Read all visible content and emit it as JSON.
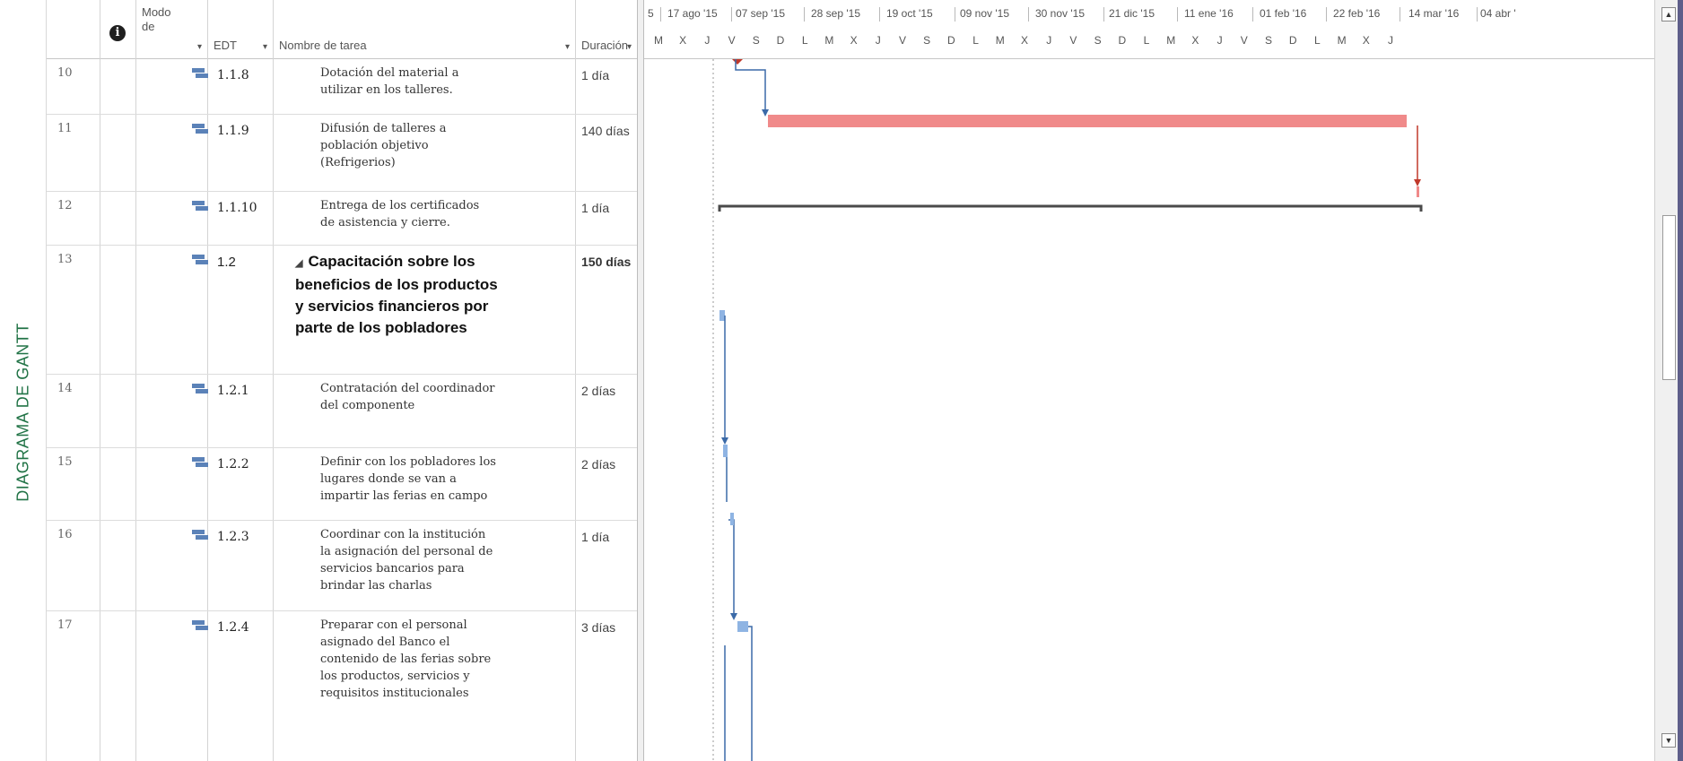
{
  "view_label": "DIAGRAMA DE GANTT",
  "headers": {
    "info_icon": "info-icon",
    "mode": "Modo de",
    "edt": "EDT",
    "name": "Nombre de tarea",
    "duration": "Duración",
    "dropdown": "▾"
  },
  "timescale": {
    "major": [
      "5",
      "17 ago '15",
      "07 sep '15",
      "28 sep '15",
      "19 oct '15",
      "09 nov '15",
      "30 nov '15",
      "21 dic '15",
      "11 ene '16",
      "01 feb '16",
      "22 feb '16",
      "14 mar '16",
      "04 abr '"
    ],
    "minor": [
      "M",
      "X",
      "J",
      "V",
      "S",
      "D",
      "L",
      "M",
      "X",
      "J",
      "V",
      "S",
      "D",
      "L",
      "M",
      "X",
      "J",
      "V",
      "S",
      "D",
      "L",
      "M",
      "X",
      "J",
      "V",
      "S",
      "D",
      "L",
      "M",
      "X",
      "J"
    ]
  },
  "rows": [
    {
      "id": "10",
      "edt": "1.1.8",
      "name": "Dotación del material a utilizar en los talleres.",
      "duration": "1 día",
      "summary": false
    },
    {
      "id": "11",
      "edt": "1.1.9",
      "name": "Difusión de talleres a población objetivo (Refrigerios)",
      "duration": "140 días",
      "summary": false
    },
    {
      "id": "12",
      "edt": "1.1.10",
      "name": "Entrega de los certificados de asistencia y cierre.",
      "duration": "1 día",
      "summary": false
    },
    {
      "id": "13",
      "edt": "1.2",
      "name": "Capacitación sobre los beneficios de los productos y servicios financieros por parte de los pobladores",
      "duration": "150 días",
      "summary": true,
      "collapse": "◢"
    },
    {
      "id": "14",
      "edt": "1.2.1",
      "name": "Contratación del coordinador del componente",
      "duration": "2 días",
      "summary": false
    },
    {
      "id": "15",
      "edt": "1.2.2",
      "name": "Definir con los pobladores los lugares donde se van a impartir las ferias en campo",
      "duration": "2 días",
      "summary": false
    },
    {
      "id": "16",
      "edt": "1.2.3",
      "name": "Coordinar con la institución la asignación del personal de servicios bancarios para brindar las charlas",
      "duration": "1 día",
      "summary": false
    },
    {
      "id": "17",
      "edt": "1.2.4",
      "name": "Preparar con el personal asignado del Banco el contenido de las ferias sobre los productos, servicios y requisitos institucionales",
      "duration": "3 días",
      "summary": false
    }
  ],
  "colors": {
    "critical_bar": "#f08a8a",
    "critical_link": "#c0392b",
    "task_bar": "#8fb4e3",
    "task_link": "#3b6aa8",
    "summary_bar": "#4a4a4a",
    "view_label": "#217346"
  },
  "scrollbar": {
    "up": "▲",
    "down": "▼"
  }
}
